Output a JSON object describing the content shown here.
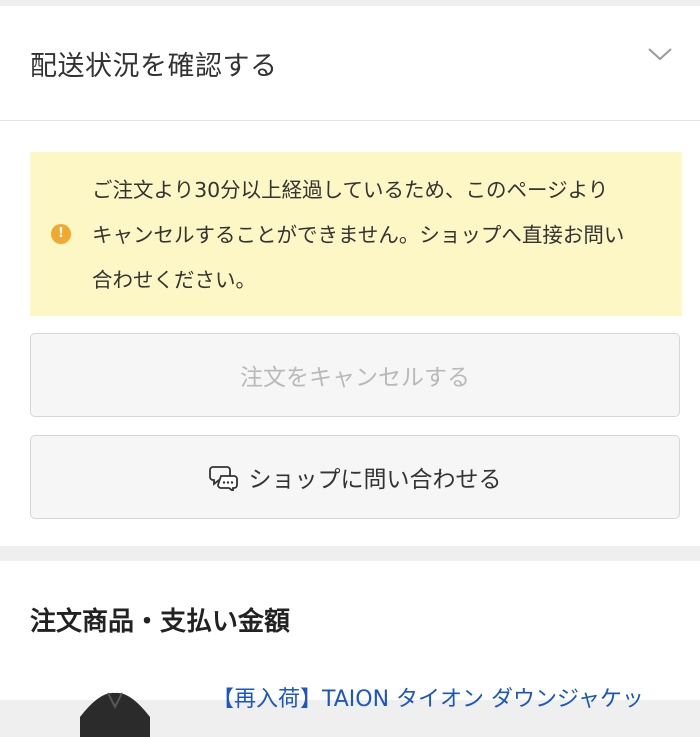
{
  "delivery": {
    "title": "配送状況を確認する"
  },
  "notice": {
    "line1": "ご注文より30分以上経過しているため、このページより",
    "line2": "キャンセルすることができません。ショップへ直接お問い",
    "line3": "合わせください。",
    "icon": "info-icon",
    "icon_glyph": "!"
  },
  "buttons": {
    "cancel_label": "注文をキャンセルする",
    "contact_label": "ショップに問い合わせる"
  },
  "summary": {
    "title": "注文商品・支払い金額",
    "product_title": "【再入荷】TAION タイオン ダウンジャケッ"
  },
  "colors": {
    "notice_bg": "#fdf6c5",
    "notice_icon": "#f0a92f",
    "link": "#1a57c4",
    "disabled_text": "#b9b9b9"
  }
}
